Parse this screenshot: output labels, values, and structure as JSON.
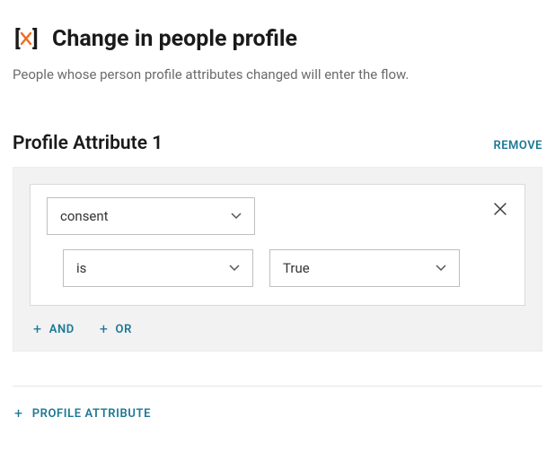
{
  "header": {
    "title": "Change in people profile",
    "description": "People whose person profile attributes changed will enter the flow."
  },
  "section": {
    "title": "Profile Attribute 1",
    "remove_label": "REMOVE"
  },
  "condition": {
    "attribute": "consent",
    "operator": "is",
    "value": "True"
  },
  "logic": {
    "and_label": "AND",
    "or_label": "OR"
  },
  "footer": {
    "add_attribute_label": "PROFILE ATTRIBUTE"
  },
  "colors": {
    "accent_orange": "#ef6b23",
    "link_teal": "#1b7894"
  }
}
